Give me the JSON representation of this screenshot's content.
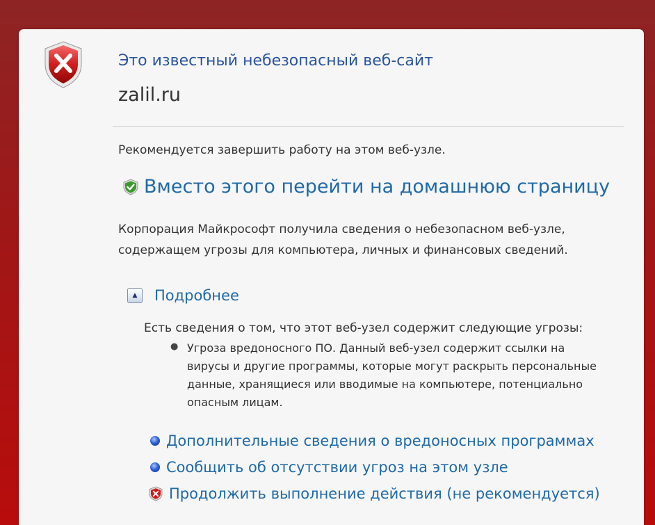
{
  "title": "Это известный небезопасный веб-сайт",
  "site": "zalil.ru",
  "recommendation": "Рекомендуется завершить работу на этом веб-узле.",
  "home_link": "Вместо этого перейти на домашнюю страницу",
  "description": "Корпорация Майкрософт получила сведения о небезопасном веб-узле, содержащем угрозы для компьютера, личных и финансовых сведений.",
  "more_info": {
    "label": "Подробнее"
  },
  "threats": {
    "heading": "Есть сведения о том, что этот веб-узел содержит следующие угрозы:",
    "items": [
      "Угроза вредоносного ПО. Данный веб-узел содержит ссылки на вирусы и другие программы, которые могут раскрыть персональные данные, хранящиеся или вводимые на компьютере, потенциально опасным лицам."
    ]
  },
  "links": [
    {
      "label": "Дополнительные сведения о вредоносных программах",
      "icon": "blue-orb-icon"
    },
    {
      "label": "Сообщить об отсутствии угроз на этом узле",
      "icon": "blue-orb-icon"
    },
    {
      "label": "Продолжить выполнение действия (не рекомендуется)",
      "icon": "red-shield-icon"
    }
  ],
  "colors": {
    "accent": "#1f6aa8",
    "title": "#2a55a0",
    "danger": "#c8161d",
    "background": "#b80c0c"
  }
}
